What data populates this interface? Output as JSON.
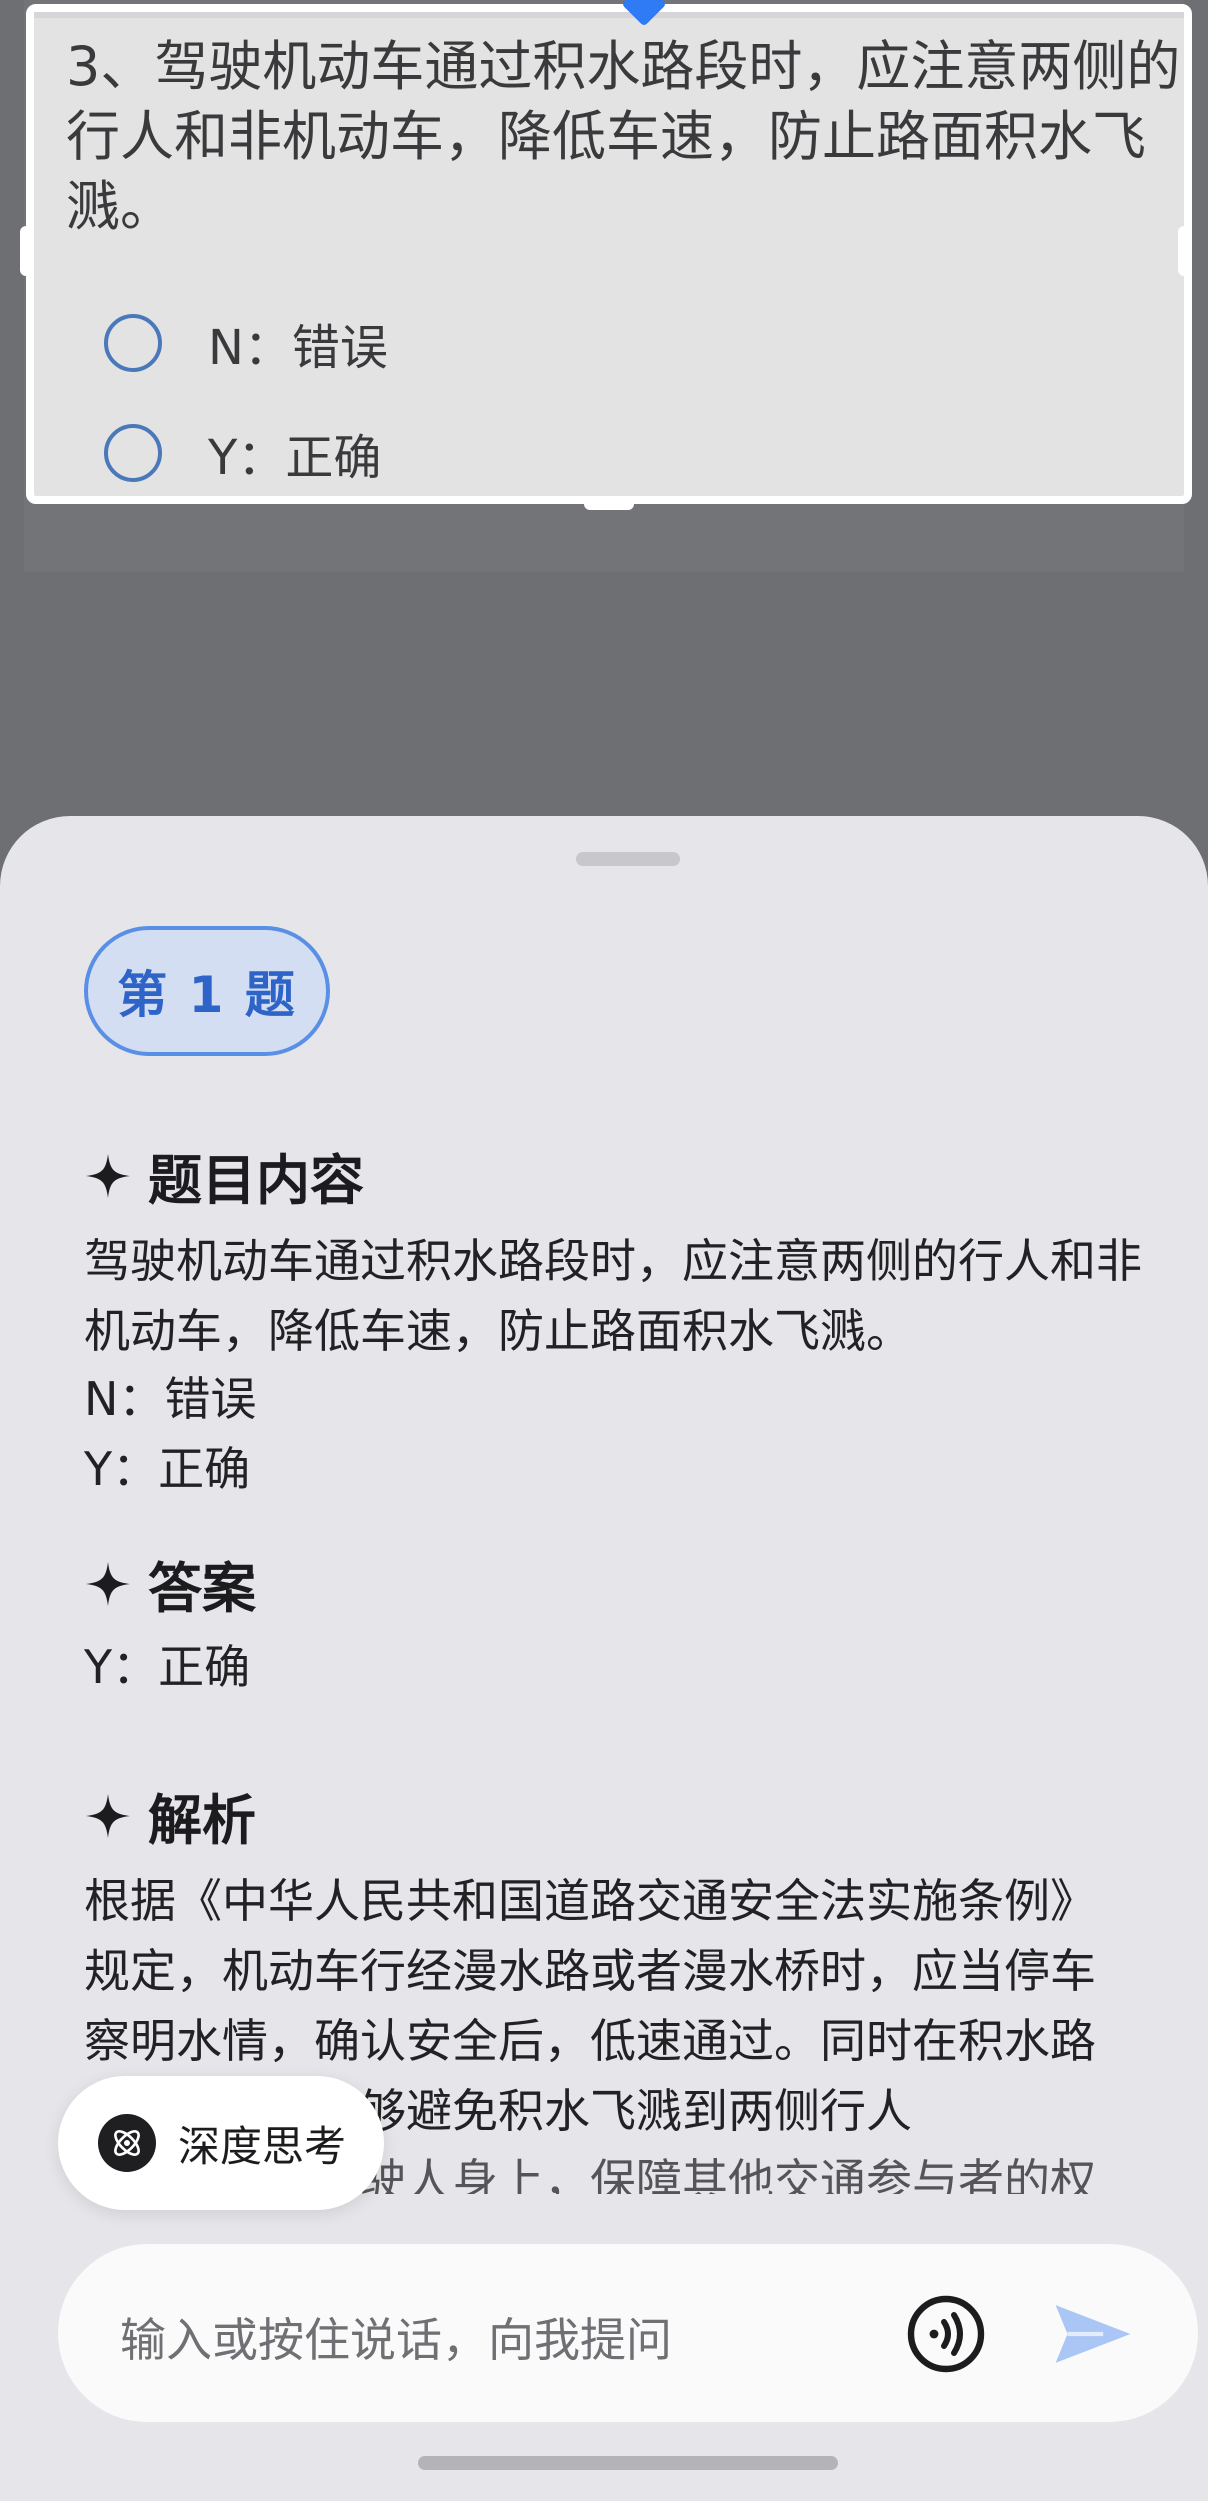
{
  "question": {
    "text": "3、驾驶机动车通过积水路段时，应注意两侧的行人和非机动车，降低车速，防止路面积水飞溅。",
    "options": [
      {
        "label": "N：错误"
      },
      {
        "label": "Y：正确"
      }
    ]
  },
  "sheet": {
    "question_badge": "第 1 题",
    "content_heading": "题目内容",
    "content_text": "驾驶机动车通过积水路段时，应注意两侧的行人和非机动车，降低车速，防止路面积水飞溅。",
    "content_options": [
      "N：错误",
      "Y：正确"
    ],
    "answer_heading": "答案",
    "answer_text": "Y：正确",
    "analysis_heading": "解析",
    "analysis_lines": [
      "根据《中华人民共和国道路交通安全法实施条例》",
      "规定，机动车行经漫水路或者漫水桥时，应当停车",
      "察明水情，确认安全后，低速通过。同时在积水路",
      "段低速行驶能够避免积水飞溅到两侧行人",
      "和非机动车驾驶人身上，保障其他交通参与者的权"
    ]
  },
  "deep_think": {
    "label": "深度思考",
    "icon": "atom-icon"
  },
  "input": {
    "placeholder": "输入或按住说话，向我提问",
    "voice_icon": "voice-icon",
    "send_icon": "send-icon"
  },
  "colors": {
    "accent": "#2e63c8",
    "send": "#a9c6f4",
    "badge_bg": "#d3def3"
  }
}
